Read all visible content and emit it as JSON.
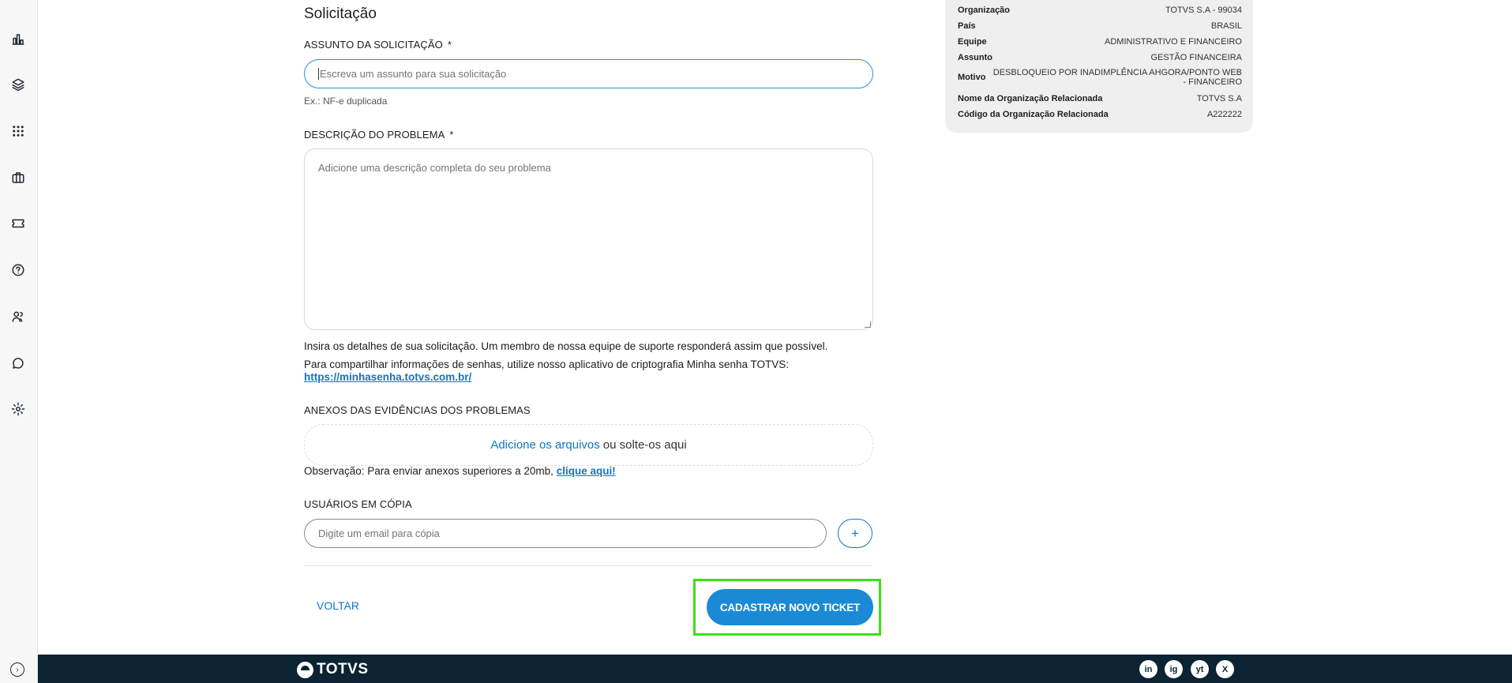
{
  "form": {
    "section_title": "Solicitação",
    "subject": {
      "label": "ASSUNTO DA SOLICITAÇÃO",
      "required_mark": "*",
      "placeholder": "Escreva um assunto para sua solicitação",
      "hint": "Ex.: NF-e duplicada"
    },
    "description": {
      "label": "DESCRIÇÃO DO PROBLEMA",
      "required_mark": "*",
      "placeholder": "Adicione uma descrição completa do seu problema"
    },
    "info_text": "Insira os detalhes de sua solicitação. Um membro de nossa equipe de suporte responderá assim que possível.",
    "password_text": "Para compartilhar informações de senhas, utilize nosso aplicativo de criptografia Minha senha TOTVS:",
    "password_link": "https://minhasenha.totvs.com.br/",
    "attachments": {
      "label": "ANEXOS DAS EVIDÊNCIAS DOS PROBLEMAS",
      "add_link": "Adicione os arquivos",
      "drop_text": "ou solte-os aqui",
      "note": "Observação: Para enviar anexos superiores a 20mb,",
      "note_link": "clique aqui!"
    },
    "cc": {
      "label": "USUÁRIOS EM CÓPIA",
      "placeholder": "Digite um email para cópia",
      "add_label": "+"
    },
    "back_label": "VOLTAR",
    "submit_label": "CADASTRAR NOVO TICKET"
  },
  "summary": {
    "rows": [
      {
        "key": "Organização",
        "value": "TOTVS S.A - 99034"
      },
      {
        "key": "País",
        "value": "BRASIL"
      },
      {
        "key": "Equipe",
        "value": "ADMINISTRATIVO E FINANCEIRO"
      },
      {
        "key": "Assunto",
        "value": "GESTÃO FINANCEIRA"
      },
      {
        "key": "Motivo",
        "value": "DESBLOQUEIO POR INADIMPLÊNCIA AHGORA/PONTO WEB - FINANCEIRO"
      },
      {
        "key": "Nome da Organização Relacionada",
        "value": "TOTVS S.A"
      },
      {
        "key": "Código da Organização Relacionada",
        "value": "A222222"
      }
    ]
  },
  "footer": {
    "brand": "TOTVS",
    "social": [
      "in",
      "ig",
      "yt",
      "X"
    ]
  },
  "sidebar": {
    "icons": [
      "chart-icon",
      "layers-icon",
      "apps-grid-icon",
      "briefcase-icon",
      "ticket-icon",
      "help-icon",
      "users-icon",
      "chat-icon",
      "settings-icon"
    ]
  }
}
